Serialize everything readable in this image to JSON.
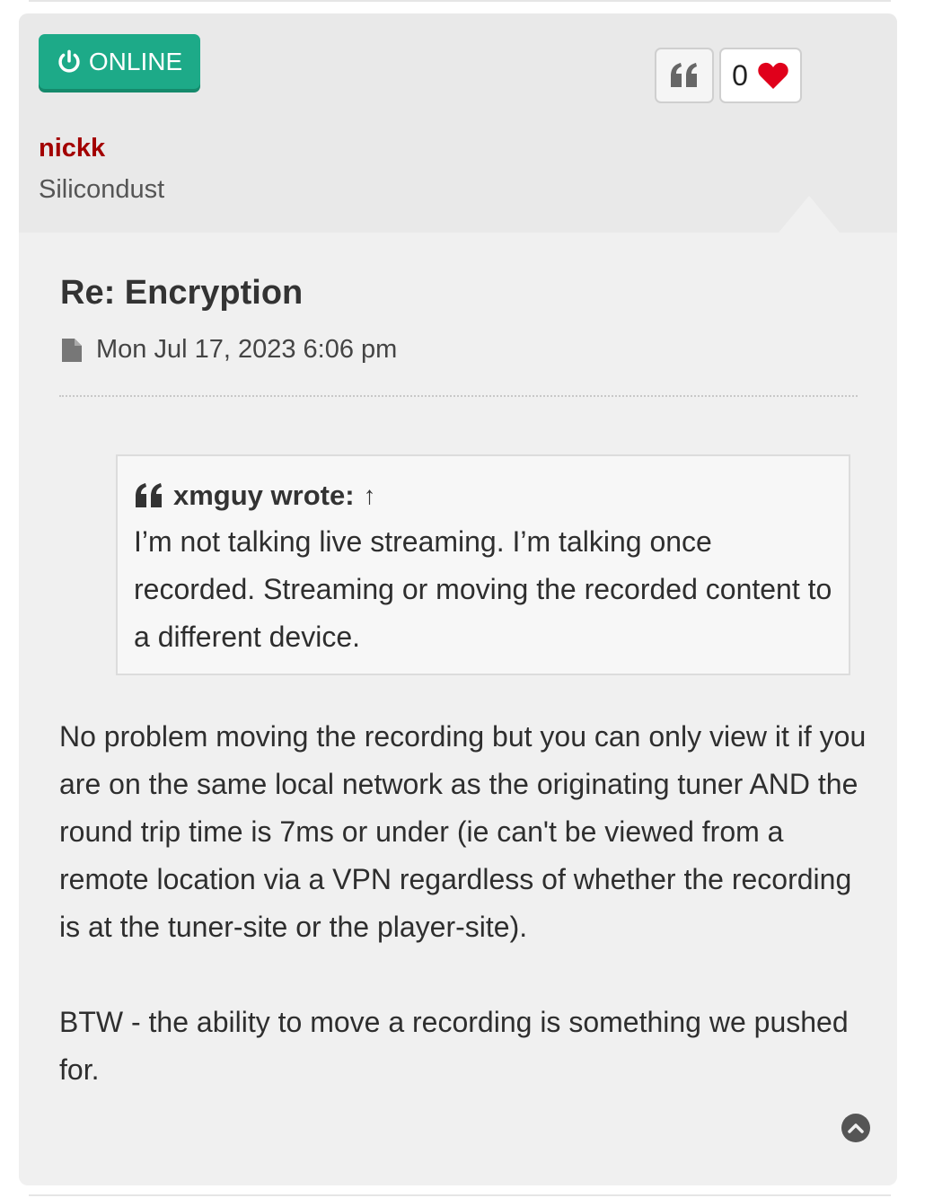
{
  "profile": {
    "status_label": "ONLINE",
    "username": "nickk",
    "rank": "Silicondust"
  },
  "actions": {
    "quote_icon": "quote-icon",
    "like_count": "0",
    "like_icon": "heart-icon"
  },
  "post": {
    "title": "Re: Encryption",
    "date": "Mon Jul 17, 2023 6:06 pm",
    "quote": {
      "author_line": "xmguy wrote:",
      "arrow": "↑",
      "text": "I’m not talking live streaming. I’m talking once recorded. Streaming or moving the recorded content to a different device."
    },
    "body_paragraphs": [
      "No problem moving the recording but you can only view it if you are on the same local network as the originating tuner AND the round trip time is 7ms or under (ie can't be viewed from a remote location via a VPN regardless of whether the recording is at the tuner-site or the player-site).",
      "BTW - the ability to move a recording is something we pushed for."
    ]
  },
  "colors": {
    "online_badge": "#1daa88",
    "username": "#a30000",
    "heart": "#e0001b"
  }
}
